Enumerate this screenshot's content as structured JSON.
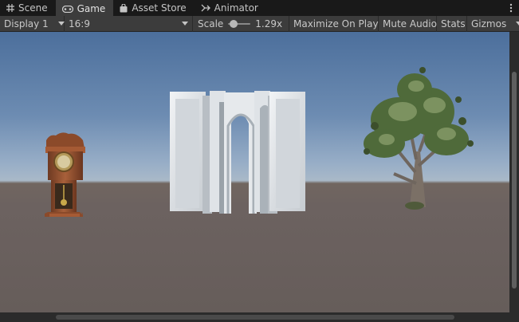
{
  "tabs": [
    {
      "label": "Scene",
      "icon": "grid-icon",
      "active": false
    },
    {
      "label": "Game",
      "icon": "gamepad-icon",
      "active": true
    },
    {
      "label": "Asset Store",
      "icon": "shopping-bag-icon",
      "active": false
    },
    {
      "label": "Animator",
      "icon": "animator-icon",
      "active": false
    }
  ],
  "toolbar": {
    "display": "Display 1",
    "aspect": "16:9",
    "scale_label": "Scale",
    "scale_value": "1.29x",
    "scale_slider_fraction": 0.1,
    "maximize_on_play": "Maximize On Play",
    "mute_audio": "Mute Audio",
    "stats": "Stats",
    "gizmos": "Gizmos"
  },
  "scene": {
    "objects": [
      "grandfather-clock",
      "stone-archway",
      "tree"
    ]
  },
  "colors": {
    "tab_bar_bg": "#191919",
    "toolbar_bg": "#3c3c3c",
    "sky_top": "#4c6f9c",
    "horizon": "#a9b9c8",
    "ground": "#6c6260"
  }
}
